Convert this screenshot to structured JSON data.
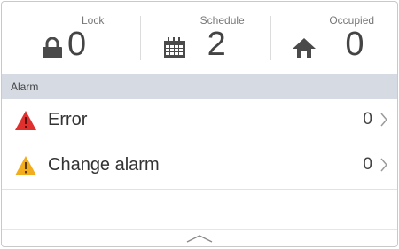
{
  "status": {
    "lock": {
      "label": "Lock",
      "value": "0",
      "icon": "padlock-icon"
    },
    "schedule": {
      "label": "Schedule",
      "value": "2",
      "icon": "calendar-icon"
    },
    "occupied": {
      "label": "Occupied",
      "value": "0",
      "icon": "house-icon"
    }
  },
  "alarm_section": {
    "title": "Alarm",
    "rows": [
      {
        "label": "Error",
        "count": "0",
        "icon": "error-warning-icon",
        "color": "#e0302e"
      },
      {
        "label": "Change alarm",
        "count": "0",
        "icon": "caution-warning-icon",
        "color": "#f1ad1d"
      }
    ]
  },
  "colors": {
    "section_header_bg": "#d6dbe3",
    "icon_dark": "#4a4a4a"
  }
}
